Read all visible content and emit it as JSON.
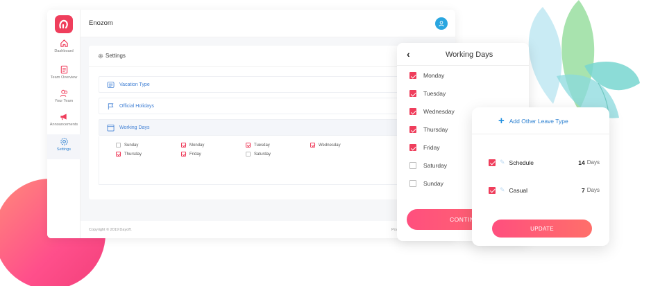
{
  "app": {
    "brand": "Enozom"
  },
  "sidebar": {
    "items": [
      {
        "label": "Dashboard",
        "icon": "home-icon"
      },
      {
        "label": "Team Overview",
        "icon": "document-icon"
      },
      {
        "label": "Your Team",
        "icon": "team-icon"
      },
      {
        "label": "Announcements",
        "icon": "megaphone-icon"
      },
      {
        "label": "Settings",
        "icon": "gear-icon",
        "active": true
      }
    ]
  },
  "settings": {
    "title": "Settings",
    "rows": [
      {
        "label": "Vacation Type",
        "icon": "vacation-list-icon"
      },
      {
        "label": "Official Holidays",
        "icon": "flag-icon"
      },
      {
        "label": "Working Days",
        "icon": "calendar-icon",
        "expanded": true
      }
    ],
    "days": [
      {
        "label": "Sunday",
        "checked": false
      },
      {
        "label": "Monday",
        "checked": true
      },
      {
        "label": "Tuesday",
        "checked": true
      },
      {
        "label": "Wednesday",
        "checked": true
      },
      {
        "label": "Thursday",
        "checked": true
      },
      {
        "label": "Friday",
        "checked": true
      },
      {
        "label": "Saturday",
        "checked": false
      }
    ]
  },
  "footer": {
    "copyright": "Copyright © 2019 Dayoff.",
    "powered": "Pow"
  },
  "working_days_panel": {
    "title": "Working Days",
    "days": [
      {
        "label": "Monday",
        "checked": true
      },
      {
        "label": "Tuesday",
        "checked": true
      },
      {
        "label": "Wednesday",
        "checked": true
      },
      {
        "label": "Thursday",
        "checked": true
      },
      {
        "label": "Friday",
        "checked": true
      },
      {
        "label": "Saturday",
        "checked": false
      },
      {
        "label": "Sunday",
        "checked": false
      }
    ],
    "continue_label": "CONTIN"
  },
  "leave_panel": {
    "add_label": "Add Other Leave Type",
    "types": [
      {
        "name": "Schedule",
        "count": "14",
        "unit": "Days",
        "checked": true
      },
      {
        "name": "Casual",
        "count": "7",
        "unit": "Days",
        "checked": true
      }
    ],
    "update_label": "UPDATE"
  },
  "colors": {
    "accent": "#ef3e5c",
    "link": "#3f7fd4",
    "avatar": "#2aa6e0",
    "blob": "#ff4f8b"
  }
}
